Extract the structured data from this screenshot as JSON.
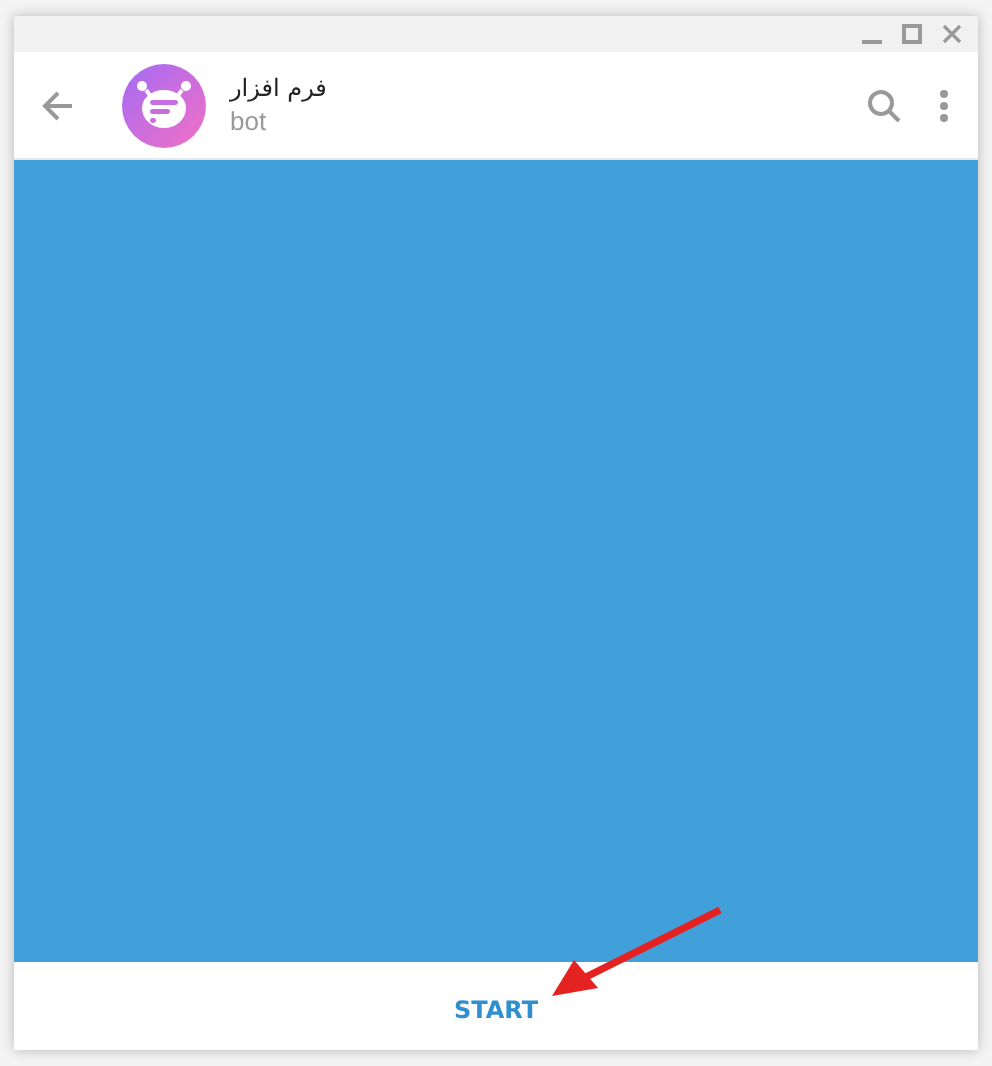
{
  "chat": {
    "title": "فرم افزار",
    "subtitle": "bot"
  },
  "start_button": {
    "label": "START"
  }
}
